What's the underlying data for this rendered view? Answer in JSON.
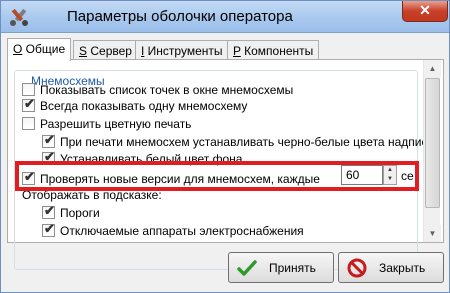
{
  "window": {
    "title": "Параметры оболочки оператора",
    "close_symbol": "✕"
  },
  "tabs": [
    {
      "key": "О",
      "label": " Общие"
    },
    {
      "key": "S",
      "label": " Сервер"
    },
    {
      "key": "I",
      "label": " Инструменты"
    },
    {
      "key": "P",
      "label": " Компоненты"
    }
  ],
  "group": {
    "title": "Мнемосхемы"
  },
  "options": [
    {
      "label": "Показывать список точек в окне мнемосхемы",
      "checked": false
    },
    {
      "label": "Всегда показывать одну мнемосхему",
      "checked": true
    },
    {
      "label": "Разрешить цветную печать",
      "checked": false
    },
    {
      "label": "При печати мнемосхем устанавливать черно-белые цвета надписей",
      "checked": true
    },
    {
      "label": "Устанавливать белый цвет фона",
      "checked": true
    },
    {
      "label": "Проверять новые версии для мнемосхем, каждые",
      "checked": true
    },
    {
      "label": "Пороги",
      "checked": true
    },
    {
      "label": "Отключаемые аппараты электроснабжения",
      "checked": true
    }
  ],
  "hint_label": "Отображать в подсказке:",
  "check_interval": {
    "value": "60",
    "unit": "се"
  },
  "check_mark": "✔",
  "buttons": {
    "apply": "Принять",
    "close": "Закрыть"
  },
  "colors": {
    "highlight": "#e21d22",
    "group_title": "#1e5aa8",
    "apply_icon": "#2e9a2e",
    "close_icon": "#c51d1d"
  }
}
